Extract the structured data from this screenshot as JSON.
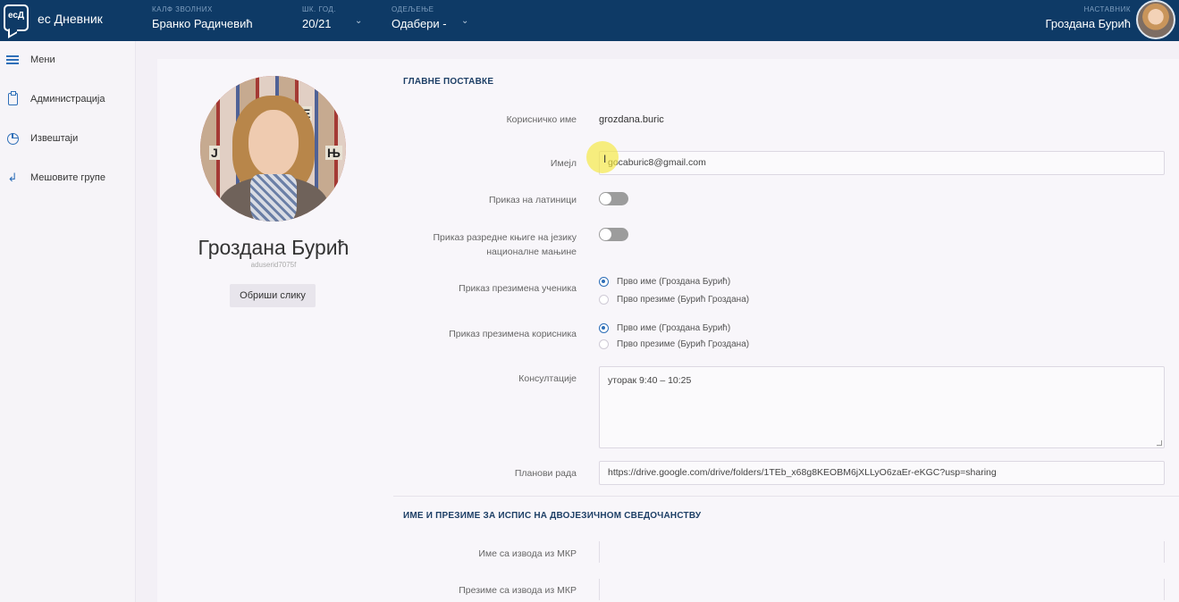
{
  "topbar": {
    "logo_text": "есД",
    "app_name": "ес Дневник",
    "school_label": "КАЛФ ЗВОЛНИХ",
    "school_value": "Бранко Радичевић",
    "year_label": "ШК. ГОД.",
    "year_value": "20/21",
    "class_label": "ОДЕЉЕЊЕ",
    "class_value": "Одабери -",
    "role_label": "НАСТАВНИК",
    "user_name": "Гроздана Бурић"
  },
  "sidebar": {
    "items": [
      {
        "label": "Мени",
        "icon": "menu-icon"
      },
      {
        "label": "Администрација",
        "icon": "clipboard-icon"
      },
      {
        "label": "Извештаји",
        "icon": "pie-chart-icon"
      },
      {
        "label": "Мешовите групе",
        "icon": "groups-icon"
      }
    ]
  },
  "profile": {
    "name": "Гроздана Бурић",
    "subtitle": "aduserid7075f",
    "delete_photo": "Обриши слику"
  },
  "main_settings": {
    "title": "ГЛАВНЕ ПОСТАВКЕ",
    "username_label": "Корисничко име",
    "username_value": "grozdana.buric",
    "email_label": "Имејл",
    "email_value": "gocaburic8@gmail.com",
    "latin_label": "Приказ на латиници",
    "latin_on": false,
    "minority_label_1": "Приказ разредне књиге на језику",
    "minority_label_2": "националне мањине",
    "minority_on": false,
    "student_order_label": "Приказ презимена ученика",
    "student_order_opt1": "Прво име (Гроздана Бурић)",
    "student_order_opt2": "Прво презиме (Бурић Гроздана)",
    "user_order_label": "Приказ презимена корисника",
    "user_order_opt1": "Прво име (Гроздана Бурић)",
    "user_order_opt2": "Прво презиме (Бурић Гроздана)",
    "consult_label": "Консултације",
    "consult_value": "уторак    9:40 – 10:25",
    "plans_label": "Планови рада",
    "plans_value": "https://drive.google.com/drive/folders/1TEb_x68g8KEOBM6jXLLyO6zaEr-eKGC?usp=sharing"
  },
  "bilingual": {
    "title": "ИМЕ И ПРЕЗИМЕ ЗА ИСПИС НА ДВОЈЕЗИЧНОМ СВЕДОЧАНСТВУ",
    "first_name_label": "Име са извода из МКР",
    "last_name_label": "Презиме са извода из МКР"
  }
}
